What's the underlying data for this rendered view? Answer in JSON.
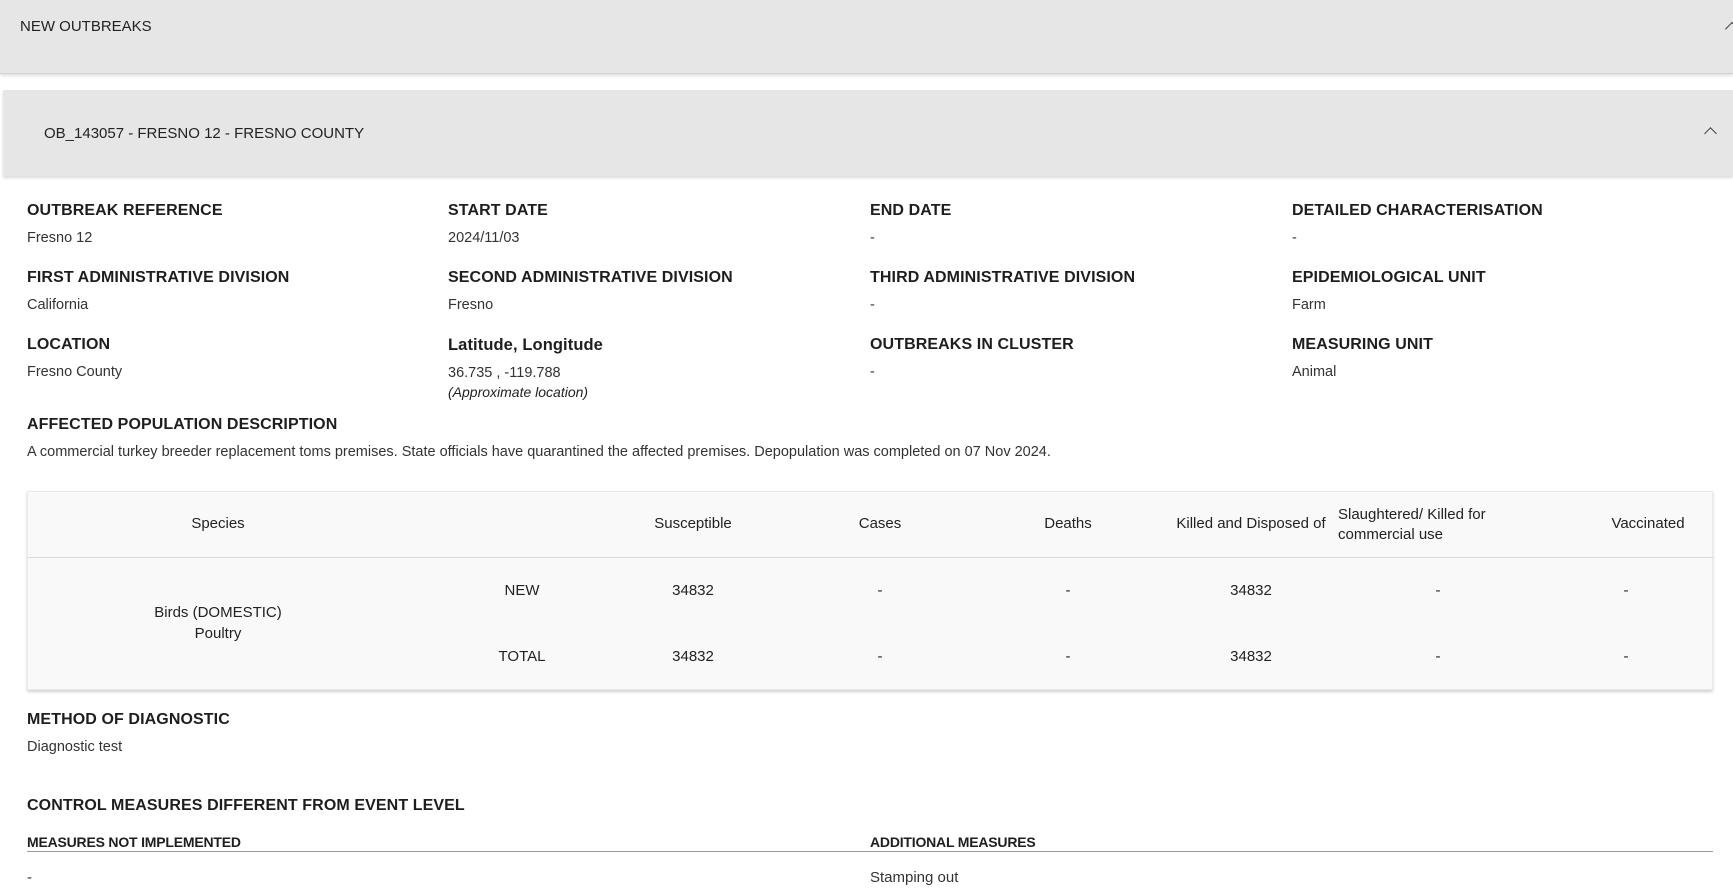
{
  "outbreaks_panel": {
    "title": "NEW OUTBREAKS"
  },
  "outbreak": {
    "title": "OB_143057 - FRESNO 12 - FRESNO COUNTY",
    "fields": {
      "outbreak_reference": {
        "label": "OUTBREAK REFERENCE",
        "value": "Fresno 12"
      },
      "start_date": {
        "label": "START DATE",
        "value": "2024/11/03"
      },
      "end_date": {
        "label": "END DATE",
        "value": "-"
      },
      "detailed_characterisation": {
        "label": "DETAILED CHARACTERISATION",
        "value": "-"
      },
      "first_admin_division": {
        "label": "FIRST ADMINISTRATIVE DIVISION",
        "value": "California"
      },
      "second_admin_division": {
        "label": "SECOND ADMINISTRATIVE DIVISION",
        "value": "Fresno"
      },
      "third_admin_division": {
        "label": "THIRD ADMINISTRATIVE DIVISION",
        "value": "-"
      },
      "epidemiological_unit": {
        "label": "EPIDEMIOLOGICAL UNIT",
        "value": "Farm"
      },
      "location": {
        "label": "LOCATION",
        "value": "Fresno County"
      },
      "lat_long": {
        "label": "Latitude, Longitude",
        "value": "36.735 , -119.788",
        "note": "(Approximate location)"
      },
      "outbreaks_in_cluster": {
        "label": "OUTBREAKS IN CLUSTER",
        "value": "-"
      },
      "measuring_unit": {
        "label": "MEASURING UNIT",
        "value": "Animal"
      }
    },
    "affected_population": {
      "label": "AFFECTED POPULATION DESCRIPTION",
      "value": "A commercial turkey breeder replacement toms premises. State officials have quarantined the affected premises. Depopulation was completed on 07 Nov 2024."
    },
    "table": {
      "headers": {
        "species": "Species",
        "susceptible": "Susceptible",
        "cases": "Cases",
        "deaths": "Deaths",
        "killed": "Killed and Disposed of",
        "slaughtered": "Slaughtered/ Killed for commercial use",
        "vaccinated": "Vaccinated"
      },
      "species_line1": "Birds (DOMESTIC)",
      "species_line2": "Poultry",
      "rows": [
        {
          "type": "NEW",
          "susceptible": "34832",
          "cases": "-",
          "deaths": "-",
          "killed": "34832",
          "slaughtered": "-",
          "vaccinated": "-"
        },
        {
          "type": "TOTAL",
          "susceptible": "34832",
          "cases": "-",
          "deaths": "-",
          "killed": "34832",
          "slaughtered": "-",
          "vaccinated": "-"
        }
      ]
    },
    "method_of_diagnostic": {
      "label": "METHOD OF DIAGNOSTIC",
      "value": "Diagnostic test"
    },
    "control_measures": {
      "label": "CONTROL MEASURES DIFFERENT FROM EVENT LEVEL",
      "not_implemented_label": "MEASURES NOT IMPLEMENTED",
      "not_implemented_value": "-",
      "additional_label": "ADDITIONAL MEASURES",
      "additional_value": "Stamping out"
    }
  }
}
